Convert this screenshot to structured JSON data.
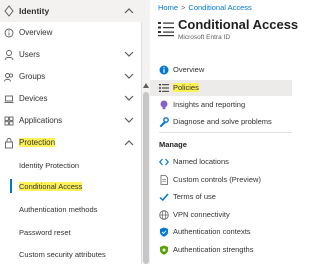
{
  "nav": {
    "identity_label": "Identity",
    "items": [
      {
        "label": "Overview"
      },
      {
        "label": "Users"
      },
      {
        "label": "Groups"
      },
      {
        "label": "Devices"
      },
      {
        "label": "Applications"
      },
      {
        "label": "Protection"
      }
    ],
    "protection_sub": [
      {
        "label": "Identity Protection"
      },
      {
        "label": "Conditional Access"
      },
      {
        "label": "Authentication methods"
      },
      {
        "label": "Password reset"
      },
      {
        "label": "Custom security attributes"
      }
    ]
  },
  "breadcrumb": {
    "home": "Home",
    "current": "Conditional Access",
    "separator": ">"
  },
  "page": {
    "title": "Conditional Access",
    "subtitle": "Microsoft Entra ID"
  },
  "menu": {
    "items": [
      {
        "label": "Overview",
        "icon": "info-icon"
      },
      {
        "label": "Policies",
        "icon": "list-icon"
      },
      {
        "label": "Insights and reporting",
        "icon": "lightbulb-icon"
      },
      {
        "label": "Diagnose and solve problems",
        "icon": "wrench-icon"
      }
    ],
    "manage_heading": "Manage",
    "manage_items": [
      {
        "label": "Named locations",
        "icon": "code-brackets-icon"
      },
      {
        "label": "Custom controls (Preview)",
        "icon": "document-icon"
      },
      {
        "label": "Terms of use",
        "icon": "checkmark-icon"
      },
      {
        "label": "VPN connectivity",
        "icon": "globe-icon"
      },
      {
        "label": "Authentication contexts",
        "icon": "shield-icon"
      },
      {
        "label": "Authentication strengths",
        "icon": "shield-green-icon"
      }
    ]
  },
  "colors": {
    "accent": "#0078d4",
    "highlight": "#fdf256",
    "selected_bg": "#edebe9"
  }
}
